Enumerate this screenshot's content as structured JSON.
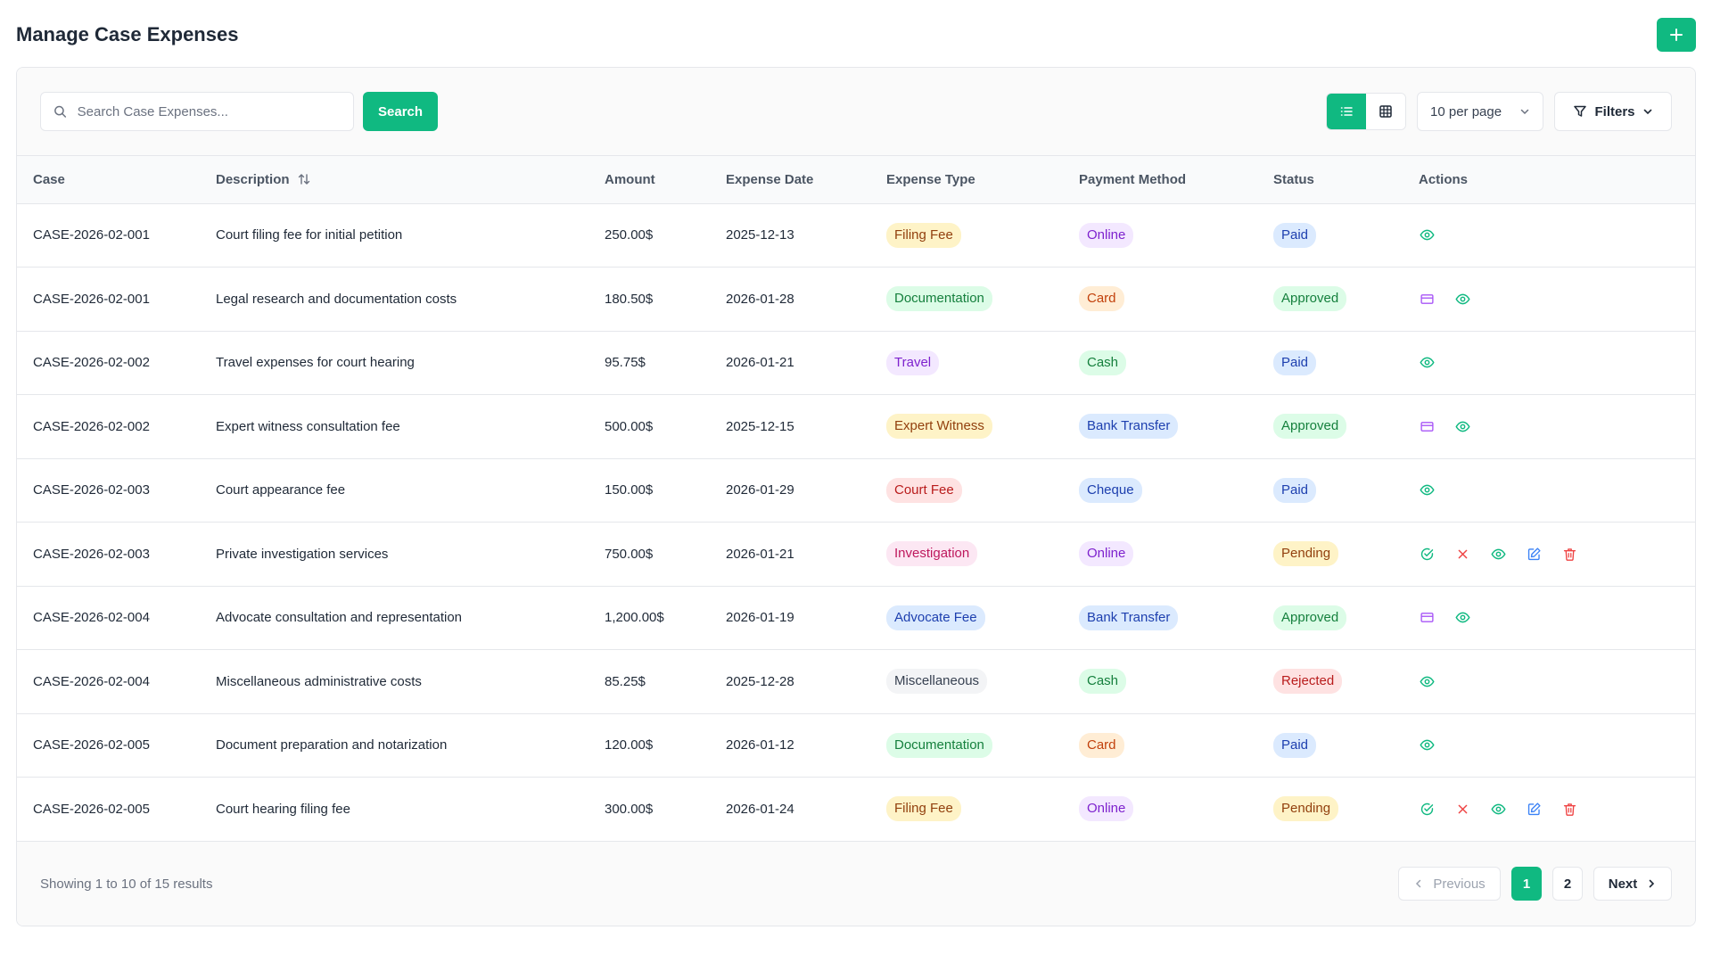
{
  "page": {
    "title": "Manage Case Expenses"
  },
  "toolbar": {
    "search_placeholder": "Search Case Expenses...",
    "search_value": "",
    "search_label": "Search",
    "view_mode": "list",
    "per_page_label": "10 per page",
    "filters_label": "Filters"
  },
  "table": {
    "columns": {
      "case": "Case",
      "description": "Description",
      "amount": "Amount",
      "date": "Expense Date",
      "type": "Expense Type",
      "payment": "Payment Method",
      "status": "Status",
      "actions": "Actions"
    },
    "rows": [
      {
        "case": "CASE-2026-02-001",
        "description": "Court filing fee for initial petition",
        "amount": "250.00$",
        "date": "2025-12-13",
        "type": "Filing Fee",
        "payment": "Online",
        "status": "Paid",
        "actions": [
          "view"
        ]
      },
      {
        "case": "CASE-2026-02-001",
        "description": "Legal research and documentation costs",
        "amount": "180.50$",
        "date": "2026-01-28",
        "type": "Documentation",
        "payment": "Card",
        "status": "Approved",
        "actions": [
          "pay",
          "view"
        ]
      },
      {
        "case": "CASE-2026-02-002",
        "description": "Travel expenses for court hearing",
        "amount": "95.75$",
        "date": "2026-01-21",
        "type": "Travel",
        "payment": "Cash",
        "status": "Paid",
        "actions": [
          "view"
        ]
      },
      {
        "case": "CASE-2026-02-002",
        "description": "Expert witness consultation fee",
        "amount": "500.00$",
        "date": "2025-12-15",
        "type": "Expert Witness",
        "payment": "Bank Transfer",
        "status": "Approved",
        "actions": [
          "pay",
          "view"
        ]
      },
      {
        "case": "CASE-2026-02-003",
        "description": "Court appearance fee",
        "amount": "150.00$",
        "date": "2026-01-29",
        "type": "Court Fee",
        "payment": "Cheque",
        "status": "Paid",
        "actions": [
          "view"
        ]
      },
      {
        "case": "CASE-2026-02-003",
        "description": "Private investigation services",
        "amount": "750.00$",
        "date": "2026-01-21",
        "type": "Investigation",
        "payment": "Online",
        "status": "Pending",
        "actions": [
          "approve",
          "reject",
          "view",
          "edit",
          "delete"
        ]
      },
      {
        "case": "CASE-2026-02-004",
        "description": "Advocate consultation and representation",
        "amount": "1,200.00$",
        "date": "2026-01-19",
        "type": "Advocate Fee",
        "payment": "Bank Transfer",
        "status": "Approved",
        "actions": [
          "pay",
          "view"
        ]
      },
      {
        "case": "CASE-2026-02-004",
        "description": "Miscellaneous administrative costs",
        "amount": "85.25$",
        "date": "2025-12-28",
        "type": "Miscellaneous",
        "payment": "Cash",
        "status": "Rejected",
        "actions": [
          "view"
        ]
      },
      {
        "case": "CASE-2026-02-005",
        "description": "Document preparation and notarization",
        "amount": "120.00$",
        "date": "2026-01-12",
        "type": "Documentation",
        "payment": "Card",
        "status": "Paid",
        "actions": [
          "view"
        ]
      },
      {
        "case": "CASE-2026-02-005",
        "description": "Court hearing filing fee",
        "amount": "300.00$",
        "date": "2026-01-24",
        "type": "Filing Fee",
        "payment": "Online",
        "status": "Pending",
        "actions": [
          "approve",
          "reject",
          "view",
          "edit",
          "delete"
        ]
      }
    ]
  },
  "badge_colors": {
    "Filing Fee": "yellow",
    "Documentation": "green",
    "Travel": "purple",
    "Expert Witness": "yellow",
    "Court Fee": "red",
    "Investigation": "pink",
    "Advocate Fee": "blue",
    "Miscellaneous": "gray",
    "Online": "purple",
    "Card": "orange",
    "Cash": "green",
    "Bank Transfer": "blue",
    "Cheque": "blue",
    "Paid": "blue",
    "Approved": "green",
    "Pending": "yellow",
    "Rejected": "red"
  },
  "icons": {
    "add": "plus-icon",
    "search": "search-icon",
    "list": "list-icon",
    "grid": "grid-icon",
    "per_page": "chevron-down-icon",
    "filters": "filter-icon",
    "sort": "sort-icon",
    "view": "eye-icon",
    "pay": "credit-card-icon",
    "approve": "check-circle-icon",
    "reject": "x-icon",
    "edit": "edit-icon",
    "delete": "trash-icon"
  },
  "colors": {
    "accent": "#10b981",
    "view": "#10b981",
    "pay": "#a855f7",
    "approve": "#10b981",
    "reject": "#ef4444",
    "edit": "#3b82f6",
    "delete": "#ef4444"
  },
  "pagination": {
    "summary": "Showing 1 to 10 of 15 results",
    "previous_label": "Previous",
    "next_label": "Next",
    "pages": [
      "1",
      "2"
    ],
    "current": "1"
  }
}
